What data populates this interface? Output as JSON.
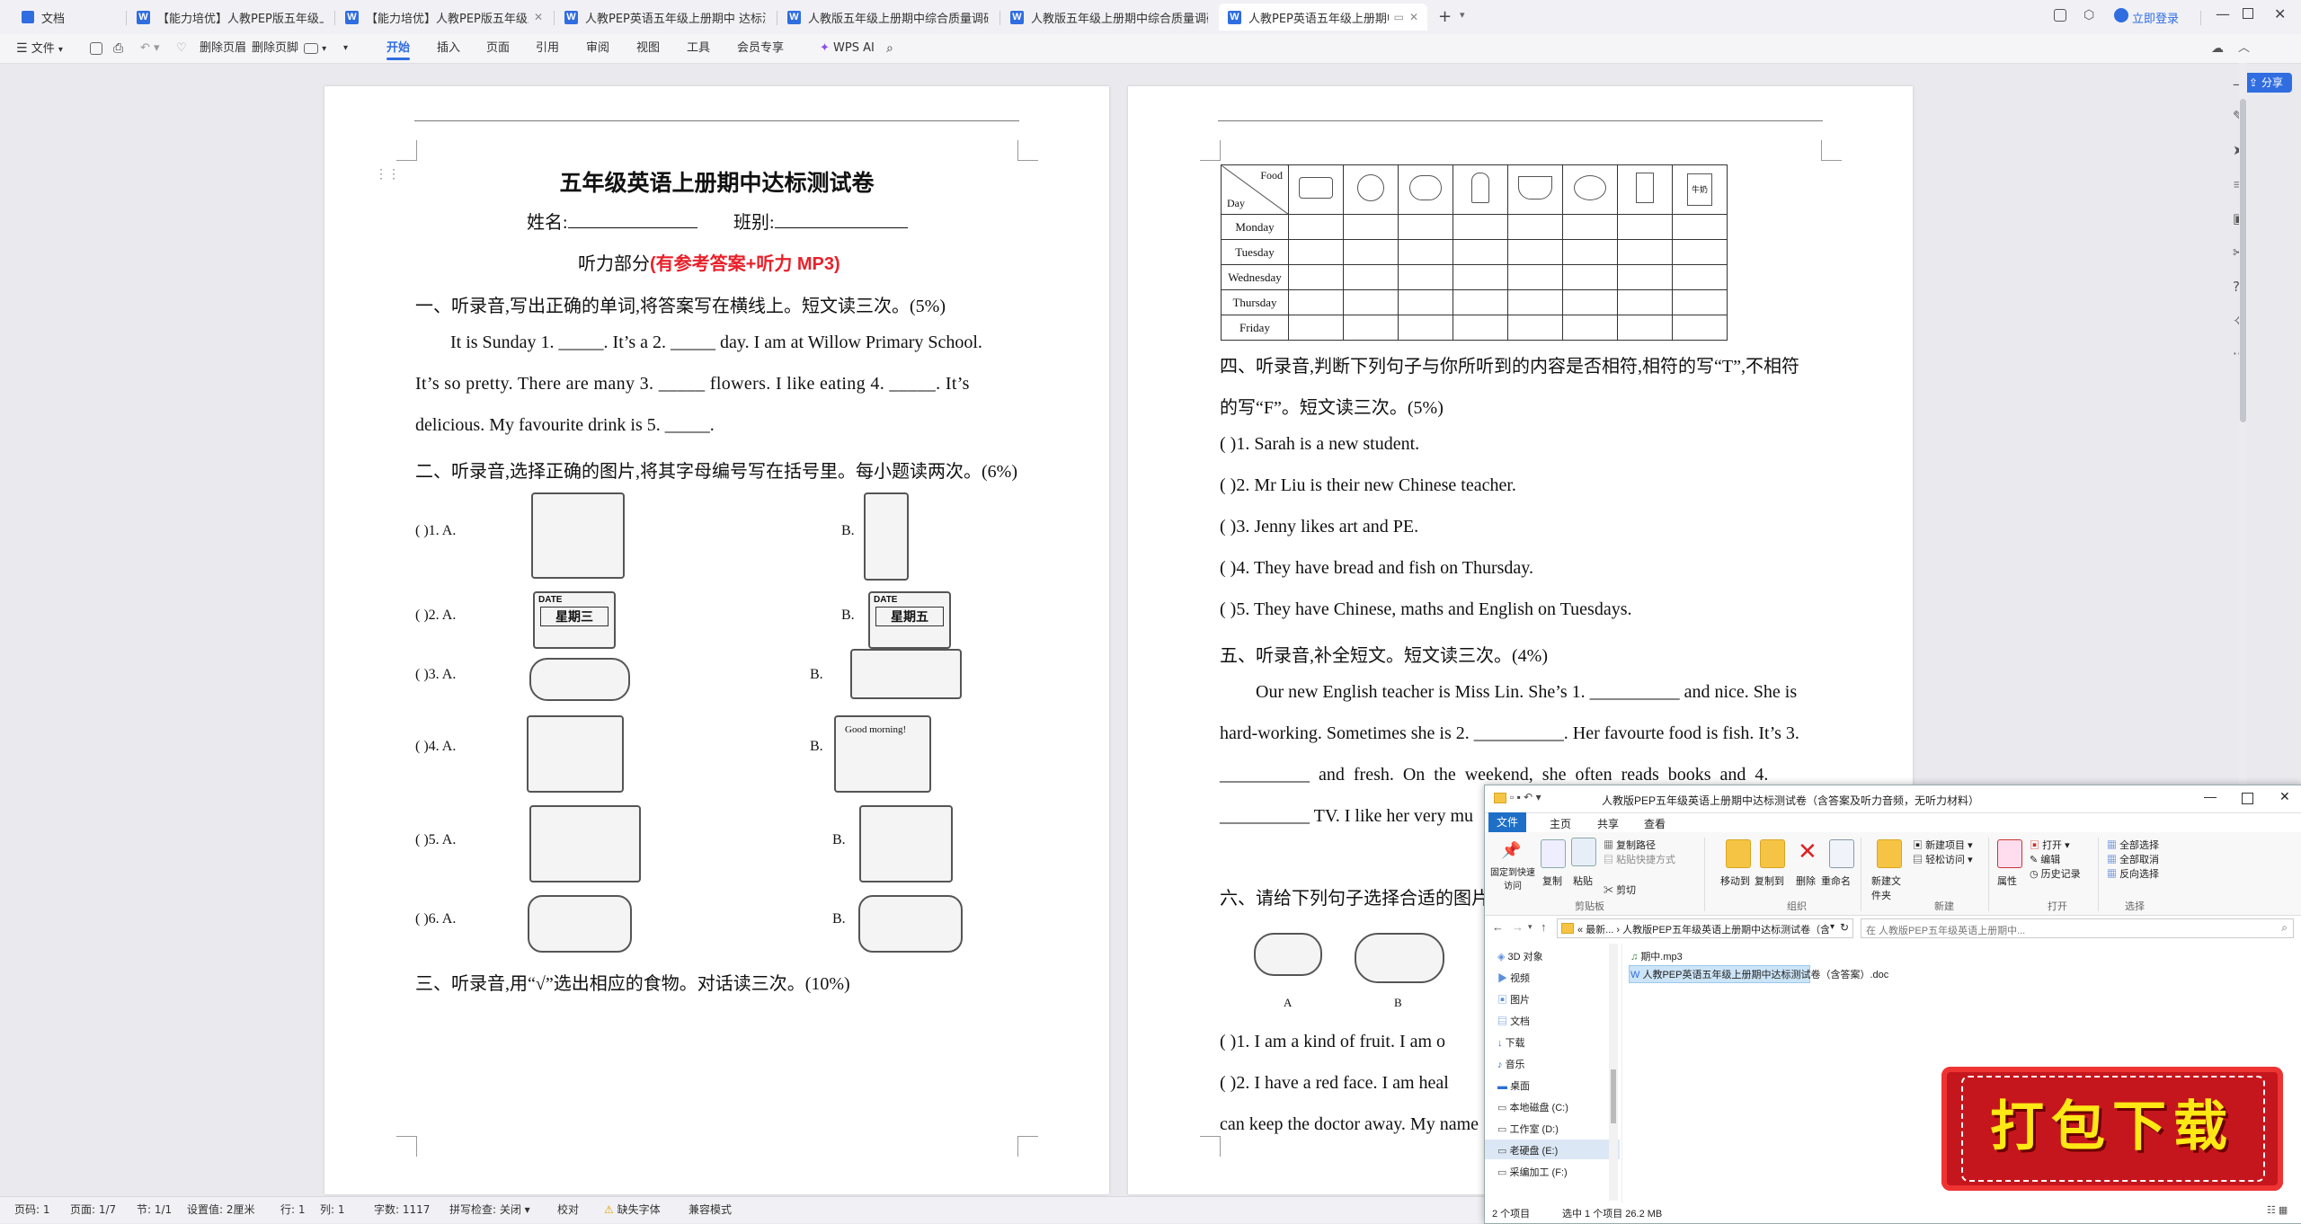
{
  "tabs": [
    {
      "label": "文档",
      "active": false
    },
    {
      "label": "【能力培优】人教PEP版五年级上册英",
      "active": false
    },
    {
      "label": "【能力培优】人教PEP版五年级上册",
      "active": false
    },
    {
      "label": "人教PEP英语五年级上册期中 达标测",
      "active": false
    },
    {
      "label": "人教版五年级上册期中综合质量调研卷",
      "active": false
    },
    {
      "label": "人教版五年级上册期中综合质量调研卷",
      "active": false
    },
    {
      "label": "人教PEP英语五年级上册期中达",
      "active": true
    }
  ],
  "titlebar": {
    "login": "立即登录",
    "share": "分享"
  },
  "ribbon": {
    "file": "文件",
    "delete_header": "删除页眉",
    "delete_footer": "删除页脚",
    "tabs": [
      "开始",
      "插入",
      "页面",
      "引用",
      "审阅",
      "视图",
      "工具",
      "会员专享"
    ],
    "wps_ai": "WPS AI"
  },
  "page1": {
    "title": "五年级英语上册期中达标测试卷",
    "name_label": "姓名:",
    "class_label": "班别:",
    "listening": "听力部分",
    "listening_note": "(有参考答案+听力 MP3)",
    "q1": "一、听录音,写出正确的单词,将答案写在横线上。短文读三次。(5%)",
    "q1_p1": "It is Sunday 1. _____. It’s a 2. _____ day. I am at Willow Primary School.",
    "q1_p2": "It’s so pretty. There are many 3. _____ flowers. I like eating 4. _____. It’s",
    "q1_p3": "delicious. My favourite drink is 5. _____.",
    "q2": "二、听录音,选择正确的图片,将其字母编号写在括号里。每小题读两次。(6%)",
    "items": [
      {
        "num": "(      )1.  A.",
        "b": "B.",
        "a_text": "",
        "b_text": ""
      },
      {
        "num": "(      )2.  A.",
        "b": "B.",
        "a_text": "星期三",
        "b_text": "星期五"
      },
      {
        "num": "(      )3.  A.",
        "b": "B.",
        "a_text": "",
        "b_text": ""
      },
      {
        "num": "(      )4.  A.",
        "b": "B.",
        "a_text": "",
        "b_text": "Good morning!"
      },
      {
        "num": "(      )5.  A.",
        "b": "B.",
        "a_text": "",
        "b_text": ""
      },
      {
        "num": "(      )6.  A.",
        "b": "B.",
        "a_text": "",
        "b_text": ""
      }
    ],
    "date_label": "DATE",
    "q3": "三、听录音,用“√”选出相应的食物。对话读三次。(10%)"
  },
  "page2": {
    "table_head_food": "Food",
    "table_head_day": "Day",
    "days": [
      "Monday",
      "Tuesday",
      "Wednesday",
      "Thursday",
      "Friday"
    ],
    "milk_label": "牛奶",
    "q4": "四、听录音,判断下列句子与你所听到的内容是否相符,相符的写“T”,不相符",
    "q4b": "的写“F”。短文读三次。(5%)",
    "tf": [
      "(        )1. Sarah is a new student.",
      "(        )2. Mr Liu is their new Chinese teacher.",
      "(        )3. Jenny likes art and PE.",
      "(        )4. They have bread and fish on Thursday.",
      "(        )5. They have Chinese, maths and English on  Tuesdays."
    ],
    "q5": "五、听录音,补全短文。短文读三次。(4%)",
    "q5_p1": "Our new English teacher is Miss Lin. She’s 1. __________ and nice. She is",
    "q5_p2": "hard-working. Sometimes she is 2. __________. Her favourte food is fish. It’s 3.",
    "q5_p3": "__________  and  fresh.  On  the  weekend,  she  often  reads  books  and  4.",
    "q5_p4": "__________ TV. I like her very mu",
    "q6": "六、请给下列句子选择合适的图片",
    "img_labels": [
      "A",
      "B"
    ],
    "s1": "(        )1. I am a kind of fruit. I am o",
    "s2": "(        )2. I have a red face. I am heal",
    "s3": "can keep the doctor away. My name"
  },
  "status": {
    "page_num": "页码: 1",
    "pages": "页面: 1/7",
    "section": "节: 1/1",
    "setting": "设置值: 2厘米",
    "row": "行: 1",
    "col": "列: 1",
    "words": "字数: 1117",
    "spell": "拼写检查: 关闭",
    "proof": "校对",
    "missing_font": "缺失字体",
    "compat": "兼容模式"
  },
  "explorer": {
    "title": "人教版PEP五年级英语上册期中达标测试卷（含答案及听力音频，无听力材料）",
    "tabs": [
      "文件",
      "主页",
      "共享",
      "查看"
    ],
    "groups": {
      "clipboard": "剪贴板",
      "organize": "组织",
      "new": "新建",
      "open": "打开",
      "select": "选择"
    },
    "buttons": {
      "pin": "固定到快速访问",
      "copy": "复制",
      "paste": "粘贴",
      "copy_path": "复制路径",
      "paste_shortcut": "粘贴快捷方式",
      "cut": "剪切",
      "move_to": "移动到",
      "copy_to": "复制到",
      "delete": "删除",
      "rename": "重命名",
      "new_folder": "新建文件夹",
      "new_item": "新建项目",
      "easy_access": "轻松访问",
      "properties": "属性",
      "open": "打开",
      "edit": "编辑",
      "history": "历史记录",
      "select_all": "全部选择",
      "select_none": "全部取消",
      "invert": "反向选择"
    },
    "path": "« 最新... › 人教版PEP五年级英语上册期中达标测试卷（含答案及听力音频，无听...",
    "search_placeholder": "在 人教版PEP五年级英语上册期中...",
    "nav": [
      "3D 对象",
      "视频",
      "图片",
      "文档",
      "下载",
      "音乐",
      "桌面",
      "本地磁盘 (C:)",
      "工作室 (D:)",
      "老硬盘 (E:)",
      "采编加工 (F:)"
    ],
    "files": [
      "期中.mp3",
      "人教PEP英语五年级上册期中达标测试卷（含答案）.doc"
    ],
    "status_count": "2 个项目",
    "status_selected": "选中 1 个项目  26.2 MB"
  },
  "banner": {
    "text": "打包下载"
  }
}
